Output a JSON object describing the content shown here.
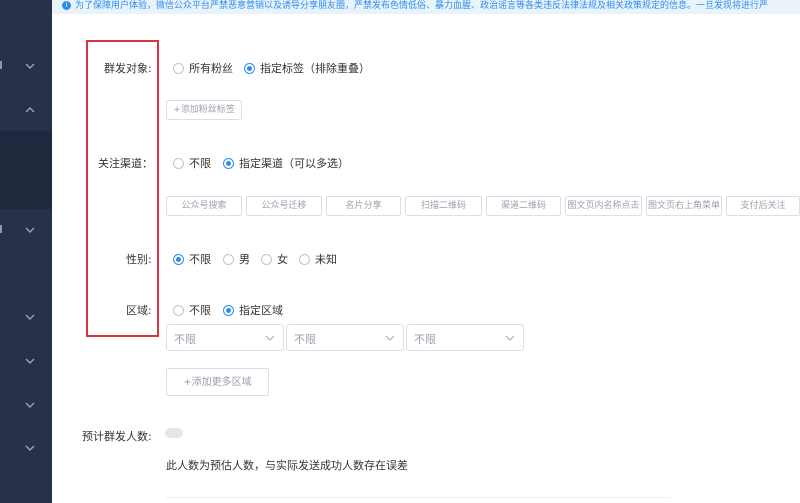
{
  "notice": {
    "text": "为了保障用户体验，微信公众平台严禁恶意营销以及诱导分享朋友圈，严禁发布色情低俗、暴力血腥、政治谣言等各类违反法律法规及相关政策规定的信息。一旦发现将进行严"
  },
  "sidebar": {
    "chevrons": [
      "down",
      "up",
      "down",
      "down",
      "down",
      "down",
      "down"
    ]
  },
  "form": {
    "target": {
      "label": "群发对象:",
      "options": [
        "所有粉丝",
        "指定标签（排除重叠）"
      ],
      "selected": 1,
      "add_button": "+添加粉丝标签"
    },
    "channel": {
      "label": "关注渠道：",
      "options": [
        "不限",
        "指定渠道（可以多选）"
      ],
      "selected": 1,
      "channels": [
        "公众号搜索",
        "公众号迁移",
        "名片分享",
        "扫描二维码",
        "渠道二维码",
        "图文页内名称点击",
        "图文页右上角菜单",
        "支付后关注"
      ]
    },
    "gender": {
      "label": "性别:",
      "options": [
        "不限",
        "男",
        "女",
        "未知"
      ],
      "selected": 0
    },
    "region": {
      "label": "区域:",
      "options": [
        "不限",
        "指定区域"
      ],
      "selected": 1,
      "selects": [
        "不限",
        "不限",
        "不限"
      ],
      "add_button": "+添加更多区域"
    },
    "estimate": {
      "label": "预计群发人数:",
      "note": "此人数为预估人数，与实际发送成功人数存在误差"
    }
  },
  "colors": {
    "accent": "#2d8cf0",
    "sidebar": "#27324a",
    "highlight": "#d9333f"
  }
}
